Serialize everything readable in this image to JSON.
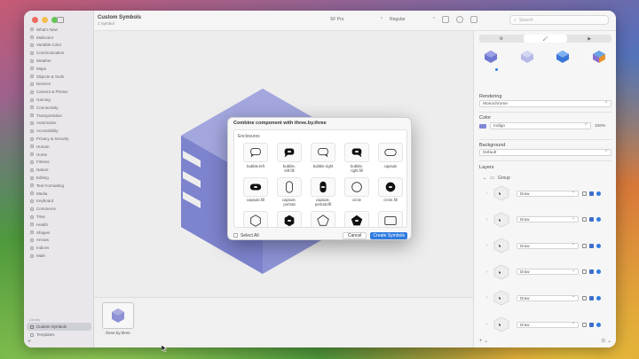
{
  "window": {
    "title": "Custom Symbols",
    "subtitle": "1 Symbol"
  },
  "toolbar": {
    "font": "SF Pro",
    "weight": "Regular",
    "search_placeholder": "Search"
  },
  "sidebar": {
    "items": [
      {
        "label": "What's New"
      },
      {
        "label": "Multicolor"
      },
      {
        "label": "Variable Color"
      },
      {
        "label": "Communication"
      },
      {
        "label": "Weather"
      },
      {
        "label": "Maps"
      },
      {
        "label": "Objects & Tools"
      },
      {
        "label": "Devices"
      },
      {
        "label": "Camera & Photos"
      },
      {
        "label": "Gaming"
      },
      {
        "label": "Connectivity"
      },
      {
        "label": "Transportation"
      },
      {
        "label": "Automotive"
      },
      {
        "label": "Accessibility"
      },
      {
        "label": "Privacy & Security"
      },
      {
        "label": "Human"
      },
      {
        "label": "Home"
      },
      {
        "label": "Fitness"
      },
      {
        "label": "Nature"
      },
      {
        "label": "Editing"
      },
      {
        "label": "Text Formatting"
      },
      {
        "label": "Media"
      },
      {
        "label": "Keyboard"
      },
      {
        "label": "Commerce"
      },
      {
        "label": "Time"
      },
      {
        "label": "Health"
      },
      {
        "label": "Shapes"
      },
      {
        "label": "Arrows"
      },
      {
        "label": "Indices"
      },
      {
        "label": "Math"
      }
    ],
    "section_label": "Library",
    "selected_item": "Custom Symbols",
    "templates_item": "Templates"
  },
  "bottom_bar": {
    "symbol_label": "three.by.three"
  },
  "inspector": {
    "tabs": [
      "⚙",
      "🖌",
      "▶"
    ],
    "rendering_label": "Rendering",
    "rendering_value": "Monochrome",
    "color_label": "Color",
    "color_value": "Indigo",
    "color_percent": "100%",
    "background_label": "Background",
    "background_value": "Default",
    "layers_label": "Layers",
    "group_label": "Group",
    "layers": [
      {
        "label": "Draw"
      },
      {
        "label": "Draw"
      },
      {
        "label": "Draw"
      },
      {
        "label": "Draw"
      },
      {
        "label": "Draw"
      },
      {
        "label": "Draw"
      }
    ],
    "colors": {
      "accent": "#2f7be0",
      "indigo": "#8087d8"
    }
  },
  "dialog": {
    "title": "Combine component with three.by.three",
    "section": "Enclosures",
    "items": [
      {
        "label": "bubble.left",
        "icon": "bubble-left-icon"
      },
      {
        "label": "bubble.\nleft.fill",
        "icon": "bubble-left-fill-icon"
      },
      {
        "label": "bubble.right",
        "icon": "bubble-right-icon"
      },
      {
        "label": "bubble.\nright.fill",
        "icon": "bubble-right-fill-icon"
      },
      {
        "label": "capsule",
        "icon": "capsule-icon"
      },
      {
        "label": "capsule.fill",
        "icon": "capsule-fill-icon"
      },
      {
        "label": "capsule.\nportrait",
        "icon": "capsule-portrait-icon"
      },
      {
        "label": "capsule.\nportrait.fill",
        "icon": "capsule-portrait-fill-icon"
      },
      {
        "label": "circle",
        "icon": "circle-icon"
      },
      {
        "label": "circle.fill",
        "icon": "circle-fill-icon"
      },
      {
        "label": "",
        "icon": "hexagon-icon"
      },
      {
        "label": "",
        "icon": "hexagon-fill-icon"
      },
      {
        "label": "",
        "icon": "pentagon-icon"
      },
      {
        "label": "",
        "icon": "pentagon-fill-icon"
      },
      {
        "label": "",
        "icon": "rectangle-icon"
      }
    ],
    "select_all": "Select All",
    "cancel": "Cancel",
    "create": "Create Symbols"
  }
}
